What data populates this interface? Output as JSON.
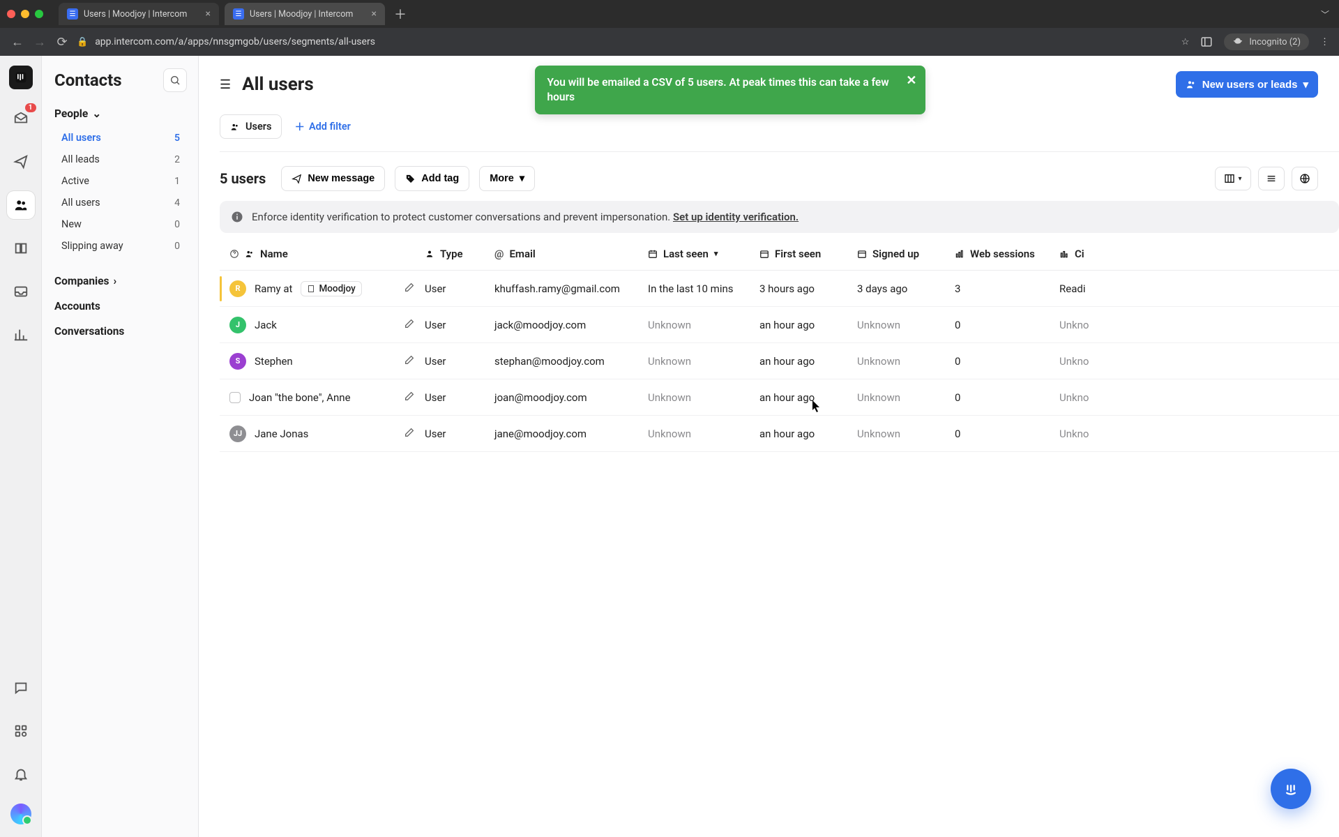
{
  "browser": {
    "tabs": [
      {
        "title": "Users | Moodjoy | Intercom"
      },
      {
        "title": "Users | Moodjoy | Intercom"
      }
    ],
    "url": "app.intercom.com/a/apps/nnsgmgob/users/segments/all-users",
    "incognito_label": "Incognito (2)"
  },
  "rail": {
    "inbox_badge": "1"
  },
  "sidebar": {
    "title": "Contacts",
    "sections": {
      "people_label": "People",
      "companies_label": "Companies",
      "accounts_label": "Accounts",
      "conversations_label": "Conversations"
    },
    "people": [
      {
        "label": "All users",
        "count": "5",
        "active": true
      },
      {
        "label": "All leads",
        "count": "2",
        "active": false
      },
      {
        "label": "Active",
        "count": "1",
        "active": false
      },
      {
        "label": "All users",
        "count": "4",
        "active": false
      },
      {
        "label": "New",
        "count": "0",
        "active": false
      },
      {
        "label": "Slipping away",
        "count": "0",
        "active": false
      }
    ]
  },
  "toast": {
    "message": "You will be emailed a CSV of 5 users. At peak times this can take a few hours"
  },
  "header": {
    "title": "All users",
    "primary_button": "New users or leads"
  },
  "filters": {
    "users_pill": "Users",
    "add_filter": "Add filter"
  },
  "actions": {
    "count_label": "5 users",
    "new_message": "New message",
    "add_tag": "Add tag",
    "more": "More"
  },
  "banner": {
    "text": "Enforce identity verification to protect customer conversations and prevent impersonation. ",
    "link": "Set up identity verification."
  },
  "columns": {
    "name": "Name",
    "type": "Type",
    "email": "Email",
    "last_seen": "Last seen",
    "first_seen": "First seen",
    "signed_up": "Signed up",
    "web_sessions": "Web sessions",
    "city": "Ci"
  },
  "rows": [
    {
      "avatar_bg": "#f5c43a",
      "avatar_text": "R",
      "name": "Ramy at",
      "company": "Moodjoy",
      "type": "User",
      "email": "khuffash.ramy@gmail.com",
      "last_seen": "In the last 10 mins",
      "first_seen": "3 hours ago",
      "signed_up": "3 days ago",
      "web_sessions": "3",
      "city": "Readi",
      "highlight": true
    },
    {
      "avatar_bg": "#33c26b",
      "avatar_text": "J",
      "name": "Jack",
      "company": "",
      "type": "User",
      "email": "jack@moodjoy.com",
      "last_seen": "Unknown",
      "first_seen": "an hour ago",
      "signed_up": "Unknown",
      "web_sessions": "0",
      "city": "Unkno",
      "highlight": false
    },
    {
      "avatar_bg": "#9b3fd1",
      "avatar_text": "S",
      "name": "Stephen",
      "company": "",
      "type": "User",
      "email": "stephan@moodjoy.com",
      "last_seen": "Unknown",
      "first_seen": "an hour ago",
      "signed_up": "Unknown",
      "web_sessions": "0",
      "city": "Unkno",
      "highlight": false
    },
    {
      "avatar_bg": "",
      "avatar_text": "",
      "name": "Joan \"the bone\", Anne",
      "company": "",
      "type": "User",
      "email": "joan@moodjoy.com",
      "last_seen": "Unknown",
      "first_seen": "an hour ago",
      "signed_up": "Unknown",
      "web_sessions": "0",
      "city": "Unkno",
      "highlight": false,
      "empty_avatar": true
    },
    {
      "avatar_bg": "#8e8e92",
      "avatar_text": "JJ",
      "name": "Jane Jonas",
      "company": "",
      "type": "User",
      "email": "jane@moodjoy.com",
      "last_seen": "Unknown",
      "first_seen": "an hour ago",
      "signed_up": "Unknown",
      "web_sessions": "0",
      "city": "Unkno",
      "highlight": false
    }
  ]
}
